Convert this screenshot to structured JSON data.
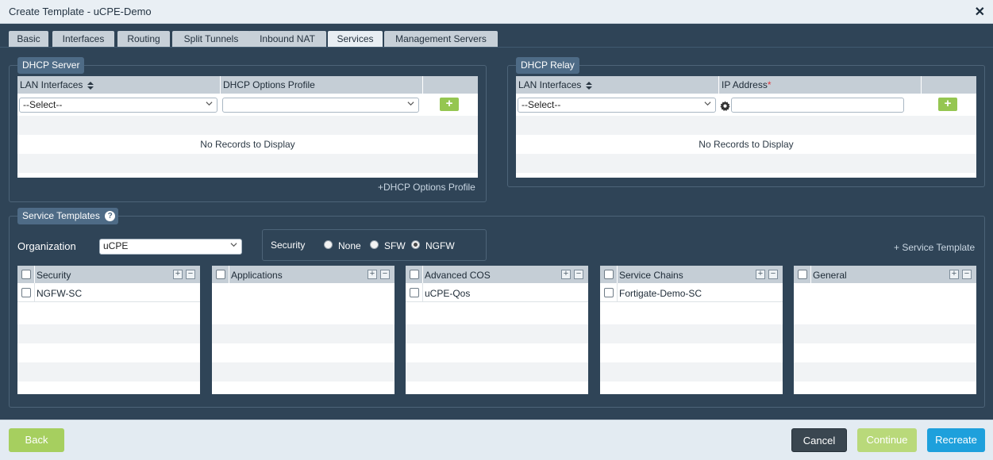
{
  "window": {
    "title": "Create Template - uCPE-Demo",
    "close_glyph": "✕"
  },
  "tabs": [
    {
      "label": "Basic"
    },
    {
      "label": "Interfaces"
    },
    {
      "label": "Routing"
    },
    {
      "label": "Split Tunnels"
    },
    {
      "label": "Inbound NAT"
    },
    {
      "label": "Services"
    },
    {
      "label": "Management Servers"
    }
  ],
  "active_tab": "Services",
  "dhcp_server": {
    "legend": "DHCP Server",
    "col_lan": "LAN Interfaces",
    "col_profile": "DHCP Options Profile",
    "lan_select_value": "--Select--",
    "profile_select_value": "",
    "add_glyph": "+",
    "empty_text": "No Records to Display",
    "options_profile_link": "+DHCP Options Profile"
  },
  "dhcp_relay": {
    "legend": "DHCP Relay",
    "col_lan": "LAN Interfaces",
    "col_ip": "IP Address",
    "required_mark": "*",
    "lan_select_value": "--Select--",
    "ip_value": "",
    "add_glyph": "+",
    "empty_text": "No Records to Display"
  },
  "service_templates": {
    "legend": "Service Templates",
    "help_glyph": "?",
    "organization_label": "Organization",
    "organization_value": "uCPE",
    "security_label": "Security",
    "security_options": [
      {
        "label": "None",
        "selected": false
      },
      {
        "label": "SFW",
        "selected": false
      },
      {
        "label": "NGFW",
        "selected": true
      }
    ],
    "add_service_template_link": "+ Service Template",
    "boxes": [
      {
        "title": "Security",
        "items": [
          "NGFW-SC"
        ]
      },
      {
        "title": "Applications",
        "items": []
      },
      {
        "title": "Advanced COS",
        "items": [
          "uCPE-Qos"
        ]
      },
      {
        "title": "Service Chains",
        "items": [
          "Fortigate-Demo-SC"
        ]
      },
      {
        "title": "General",
        "items": []
      }
    ]
  },
  "footer": {
    "back_label": "Back",
    "cancel_label": "Cancel",
    "continue_label": "Continue",
    "recreate_label": "Recreate"
  },
  "colors": {
    "background": "#2f4457",
    "legend_bg": "#4e6b86",
    "add_green": "#95c651",
    "back_green": "#a6cf5f",
    "cancel_dark": "#3a4650",
    "recreate_blue": "#1ea0dc"
  },
  "icons": {
    "sort": "sort-icon",
    "chevron": "chevron-down-icon",
    "gear": "gear-icon",
    "help": "help-icon",
    "close": "close-icon"
  }
}
